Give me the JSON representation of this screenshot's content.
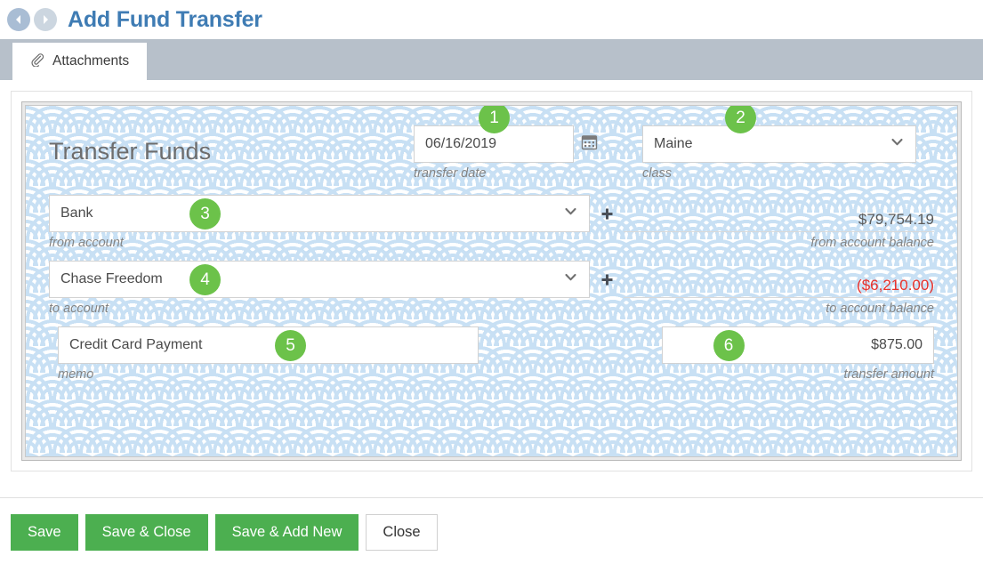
{
  "header": {
    "title": "Add Fund Transfer",
    "back_icon": "arrow-left-circle-icon",
    "forward_icon": "arrow-right-circle-icon",
    "accent_color": "#3f7cb4"
  },
  "tabs": [
    {
      "label": "Attachments",
      "icon": "paperclip-icon",
      "active": true
    }
  ],
  "form": {
    "title": "Transfer Funds",
    "transfer_date": {
      "value": "06/16/2019",
      "label": "transfer date",
      "badge": "1",
      "icon": "calendar-icon"
    },
    "class": {
      "value": "Maine",
      "label": "class",
      "badge": "2",
      "icon": "chevron-down-icon"
    },
    "from_account": {
      "value": "Bank",
      "label": "from account",
      "badge": "3",
      "icon": "chevron-down-icon",
      "add_icon": "plus-icon"
    },
    "from_balance": {
      "value": "$79,754.19",
      "label": "from account balance",
      "negative": false
    },
    "to_account": {
      "value": "Chase Freedom",
      "label": "to account",
      "badge": "4",
      "icon": "chevron-down-icon",
      "add_icon": "plus-icon"
    },
    "to_balance": {
      "value": "($6,210.00)",
      "label": "to account balance",
      "negative": true
    },
    "memo": {
      "value": "Credit Card Payment",
      "label": "memo",
      "badge": "5"
    },
    "transfer_amount": {
      "value": "$875.00",
      "label": "transfer amount",
      "badge": "6"
    }
  },
  "footer": {
    "buttons": [
      {
        "label": "Save",
        "style": "green"
      },
      {
        "label": "Save & Close",
        "style": "green"
      },
      {
        "label": "Save & Add New",
        "style": "green"
      },
      {
        "label": "Close",
        "style": "white"
      }
    ]
  },
  "colors": {
    "badge_green": "#6cc24a",
    "button_green": "#4caf50",
    "negative_red": "#e8312b",
    "pattern_blue": "#c8e0f4",
    "title_blue": "#3f7cb4"
  }
}
